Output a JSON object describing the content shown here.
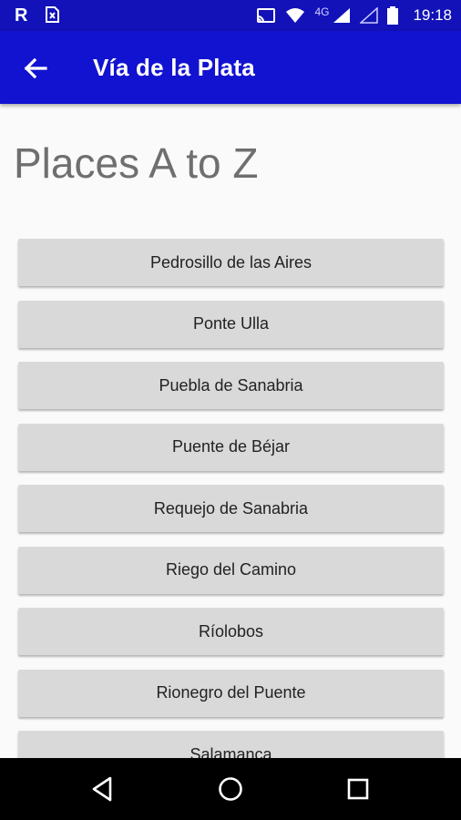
{
  "status_bar": {
    "time": "19:18",
    "network_label": "4G",
    "icons": [
      "r-app-icon",
      "sim-alert-icon",
      "cast-icon",
      "wifi-icon",
      "signal-icon",
      "signal-secondary-icon",
      "battery-icon"
    ]
  },
  "app_bar": {
    "title": "Vía de la Plata",
    "back_icon": "arrow-back-icon"
  },
  "main": {
    "heading": "Places A to Z",
    "places": [
      "Pedrosillo de las Aires",
      "Ponte Ulla",
      "Puebla de Sanabria",
      "Puente de Béjar",
      "Requejo de Sanabria",
      "Riego del Camino",
      "Ríolobos",
      "Rionegro del Puente",
      "Salamanca"
    ]
  },
  "nav_bar": {
    "icons": [
      "back-triangle-icon",
      "home-circle-icon",
      "recents-square-icon"
    ]
  },
  "colors": {
    "app_bar": "#1212d1",
    "status_bar": "#1212b8",
    "button_bg": "#d9d9d9",
    "heading_text": "#6f6f6f"
  }
}
